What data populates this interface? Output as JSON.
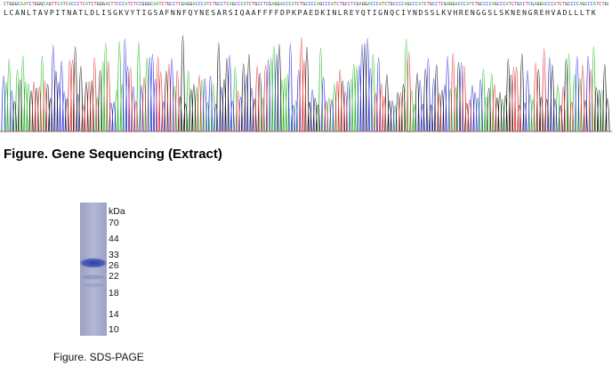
{
  "sequencing": {
    "dna_sequence": "CTGGGCAATCTGGGCAGTTCATCACCCTCATCTGGGACTTCCCATCTCCGGGCAATCTGCCTCGAGGACCCATCTGCCTCAGCCCATCTGCCTCGAGGACCCATCTGCCCCAGCCCATCTGCCTCGAGGACCCATCTGCCCCAGCCCATCTGCCTCGAGGACCCATCTGCCCCAGCCCATCTGCCTCGAGGACCCATCTGCCCCAGCCCATCTGCCTCGAGGACCCATCTGCCCCAGCC",
    "amino_acid_sequence": "LCANLTAVPITNATLDLISGKVYTIGSAFNNFQYNESARSIQAAFFFFDPKPAEDKINLREYQTIGNQCIYNDSSLKVHRENGGSLSKNENGREHVADLLLTK",
    "caption": "Figure. Gene Sequencing (Extract)",
    "trace_colors": {
      "A": "#22b822",
      "C": "#2a2ae0",
      "G": "#111111",
      "T": "#e02a2a"
    }
  },
  "sds_page": {
    "unit_label": "kDa",
    "markers": [
      "70",
      "44",
      "33",
      "26",
      "22",
      "18",
      "14",
      "10"
    ],
    "caption": "Figure. SDS-PAGE",
    "lane_color": "#a9adcc",
    "band_color": "#3b4cb0"
  }
}
